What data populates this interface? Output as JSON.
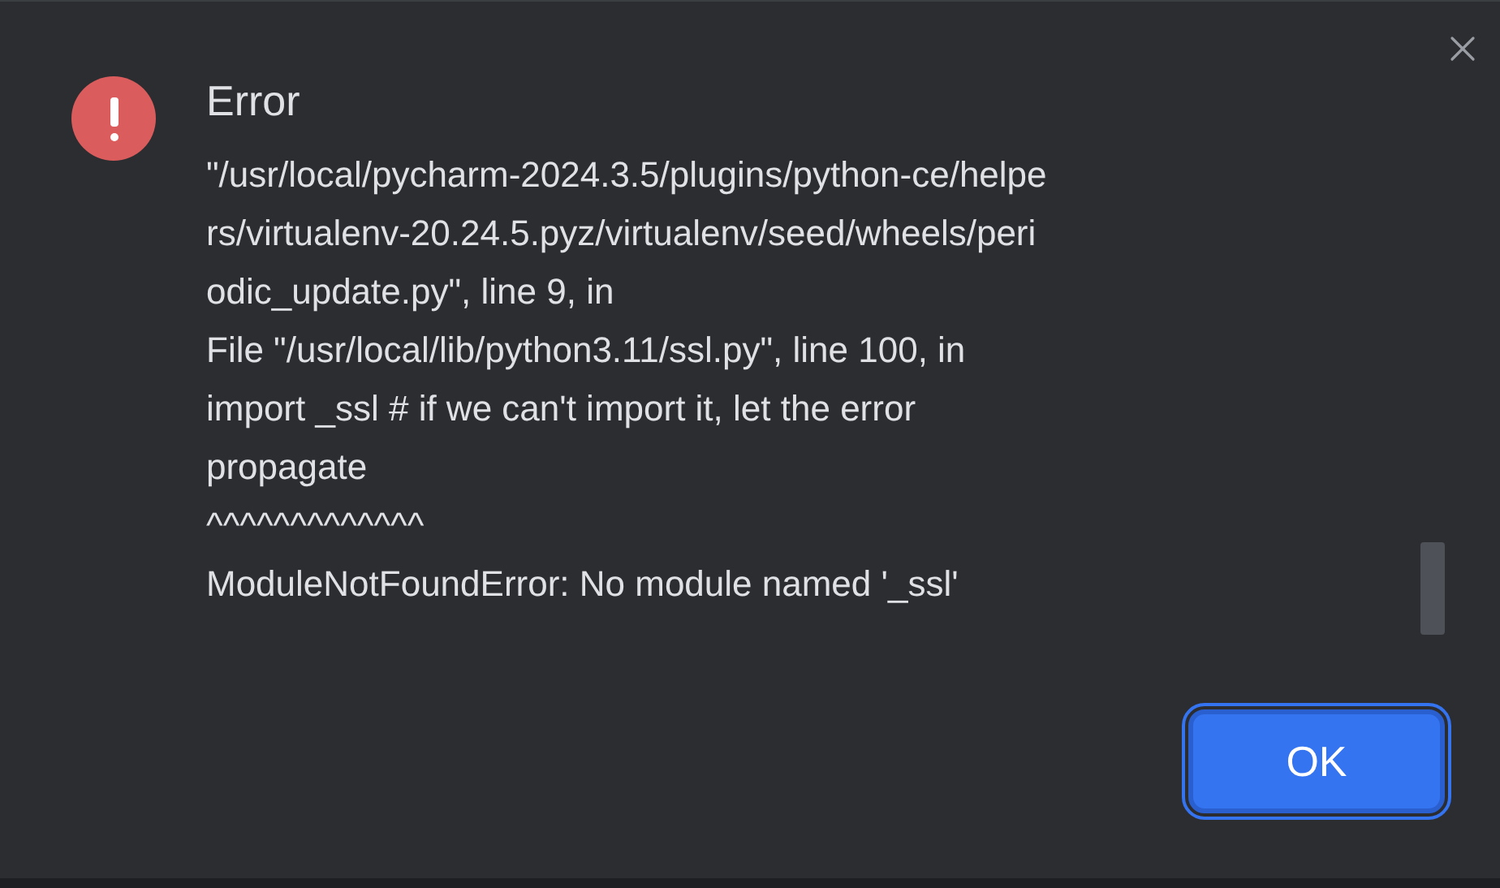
{
  "dialog": {
    "title": "Error",
    "message_lines": [
      "\"/usr/local/pycharm-2024.3.5/plugins/python-ce/helpe",
      "rs/virtualenv-20.24.5.pyz/virtualenv/seed/wheels/peri",
      "odic_update.py\", line 9, in",
      "File \"/usr/local/lib/python3.11/ssl.py\", line 100, in",
      "import _ssl # if we can't import it, let the error",
      "propagate",
      "^^^^^^^^^^^^^",
      "ModuleNotFoundError: No module named '_ssl'"
    ],
    "buttons": [
      {
        "label": "OK",
        "default": true
      }
    ]
  }
}
